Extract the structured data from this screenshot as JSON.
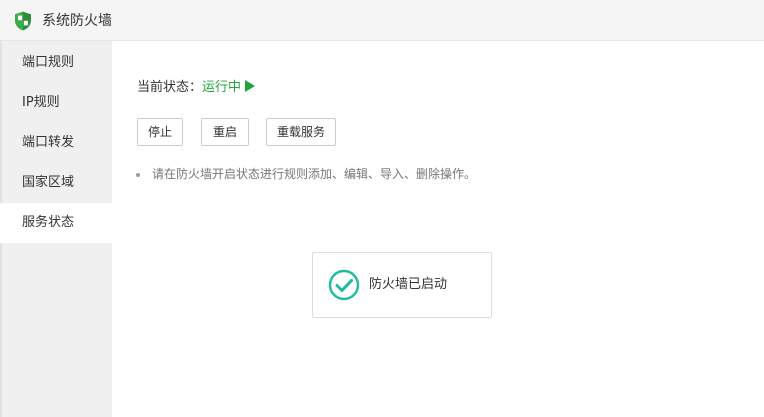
{
  "window": {
    "title": "系统防火墙",
    "icon": "shield-icon"
  },
  "sidebar": {
    "items": [
      {
        "label": "端口规则",
        "active": false
      },
      {
        "label": "IP规则",
        "active": false
      },
      {
        "label": "端口转发",
        "active": false
      },
      {
        "label": "国家区域",
        "active": false
      },
      {
        "label": "服务状态",
        "active": true
      }
    ]
  },
  "main": {
    "status_label": "当前状态：",
    "status_value": "运行中",
    "status_icon": "play-icon",
    "buttons": {
      "stop": "停止",
      "restart": "重启",
      "reload": "重载服务"
    },
    "note": "请在防火墙开启状态进行规则添加、编辑、导入、删除操作。",
    "status_box": {
      "icon": "check-circle-icon",
      "text": "防火墙已启动"
    }
  },
  "colors": {
    "accent": "#20a53a",
    "check": "#1ebc9c",
    "sidebar_bg": "#f0f0f0",
    "titlebar_bg": "#f5f5f5"
  }
}
